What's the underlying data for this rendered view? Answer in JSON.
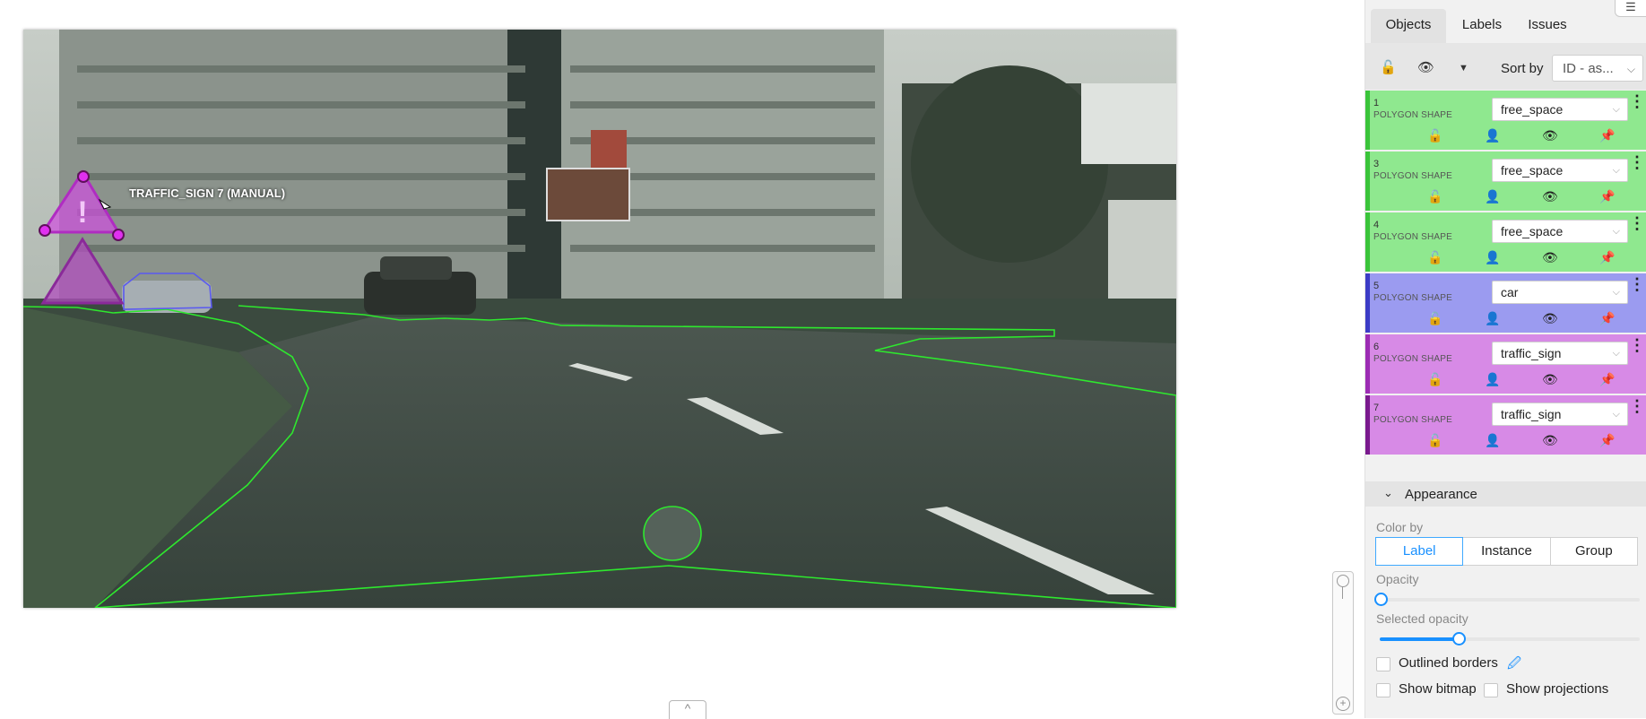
{
  "canvas": {
    "object_label": "TRAFFIC_SIGN 7 (MANUAL)",
    "collapse_icon": "^",
    "zoom_plus_icon": "+"
  },
  "sidebar": {
    "tabs": [
      {
        "label": "Objects",
        "active": true
      },
      {
        "label": "Labels",
        "active": false
      },
      {
        "label": "Issues",
        "active": false
      }
    ],
    "toolbar": {
      "lock_icon": "🔓",
      "eye_icon": "👁",
      "caret_icon": "▼",
      "sort_label": "Sort by",
      "sort_value": "ID - as...",
      "sort_chevron": "⌵"
    },
    "objects": [
      {
        "id": "1",
        "type": "POLYGON SHAPE",
        "label": "free_space",
        "color": "#8fe88f",
        "border": "#3ac43a"
      },
      {
        "id": "3",
        "type": "POLYGON SHAPE",
        "label": "free_space",
        "color": "#8fe88f",
        "border": "#3ac43a"
      },
      {
        "id": "4",
        "type": "POLYGON SHAPE",
        "label": "free_space",
        "color": "#8fe88f",
        "border": "#3ac43a"
      },
      {
        "id": "5",
        "type": "POLYGON SHAPE",
        "label": "car",
        "color": "#9b9bf0",
        "border": "#3c3cc6"
      },
      {
        "id": "6",
        "type": "POLYGON SHAPE",
        "label": "traffic_sign",
        "color": "#d78ae6",
        "border": "#9c2cb4"
      },
      {
        "id": "7",
        "type": "POLYGON SHAPE",
        "label": "traffic_sign",
        "color": "#d78ae6",
        "border": "#7a1a8e"
      }
    ],
    "object_icons": {
      "lock": "🔓",
      "user": "👤",
      "eye": "👁",
      "pin": "📌",
      "menu": "⋮",
      "chevron": "⌵"
    },
    "appearance": {
      "title": "Appearance",
      "chevron": "⌄",
      "color_by_label": "Color by",
      "color_by_options": [
        "Label",
        "Instance",
        "Group"
      ],
      "color_by_selected": "Label",
      "opacity_label": "Opacity",
      "opacity_value": 0.0,
      "selected_opacity_label": "Selected opacity",
      "selected_opacity_value": 0.3,
      "outlined_borders_label": "Outlined borders",
      "outlined_borders_checked": false,
      "picker_icon": "🖉",
      "show_bitmap_label": "Show bitmap",
      "show_bitmap_checked": false,
      "show_projections_label": "Show projections",
      "show_projections_checked": false
    }
  }
}
